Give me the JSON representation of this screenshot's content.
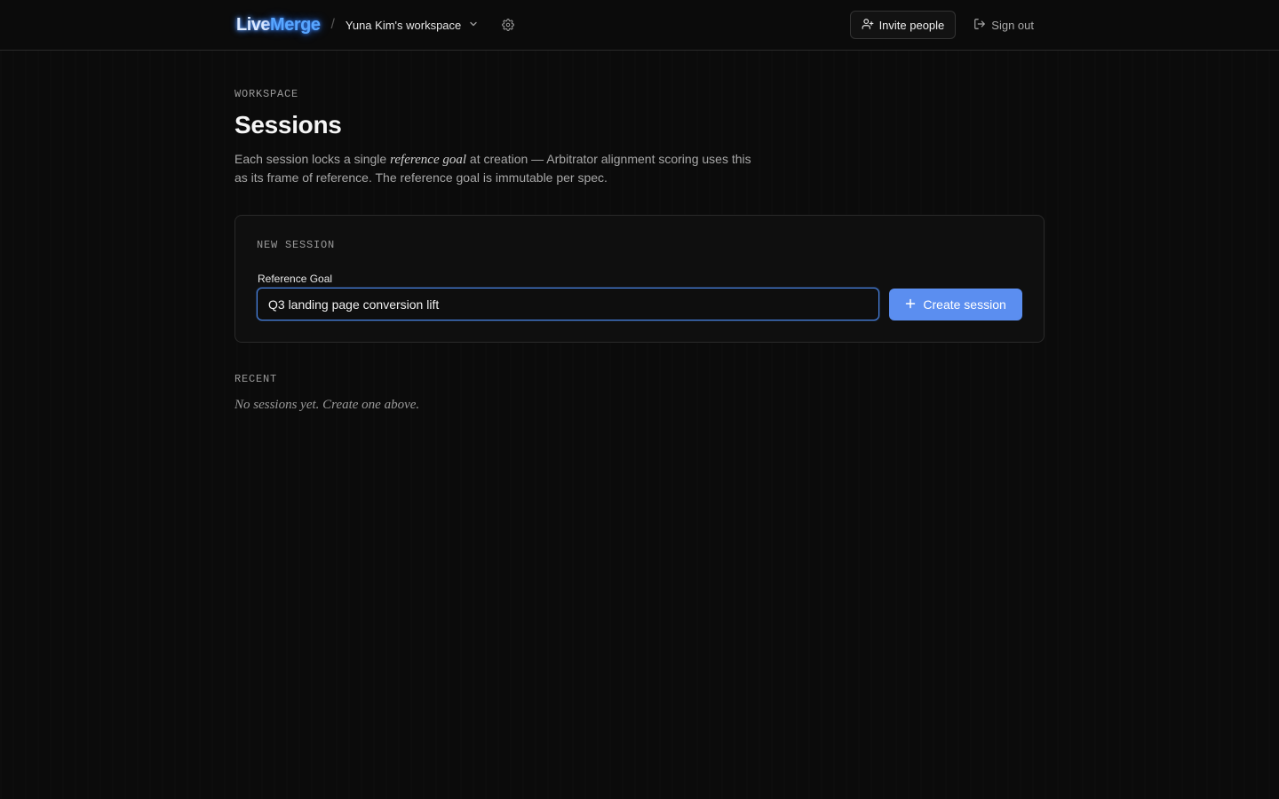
{
  "header": {
    "logo_part1": "Live",
    "logo_part2": "Merge",
    "separator": "/",
    "workspace_name": "Yuna Kim's workspace",
    "invite_label": "Invite people",
    "signout_label": "Sign out"
  },
  "page": {
    "eyebrow": "WORKSPACE",
    "title": "Sessions",
    "desc_before": "Each session locks a single ",
    "desc_em": "reference goal",
    "desc_after": " at creation — Arbitrator alignment scoring uses this as its frame of reference. The reference goal is immutable per spec."
  },
  "new_session": {
    "eyebrow": "NEW SESSION",
    "field_label": "Reference Goal",
    "field_value": "Q3 landing page conversion lift",
    "create_label": "Create session"
  },
  "recent": {
    "eyebrow": "RECENT",
    "empty_text": "No sessions yet. Create one above."
  },
  "icons": {
    "workspace_caret": "chevron-down-icon",
    "settings": "gear-icon",
    "invite": "user-plus-icon",
    "signout": "log-out-icon",
    "create": "plus-icon"
  },
  "colors": {
    "accent": "#5b8ef0",
    "focus_border": "#4a86e8",
    "background": "#0b0b0b"
  }
}
